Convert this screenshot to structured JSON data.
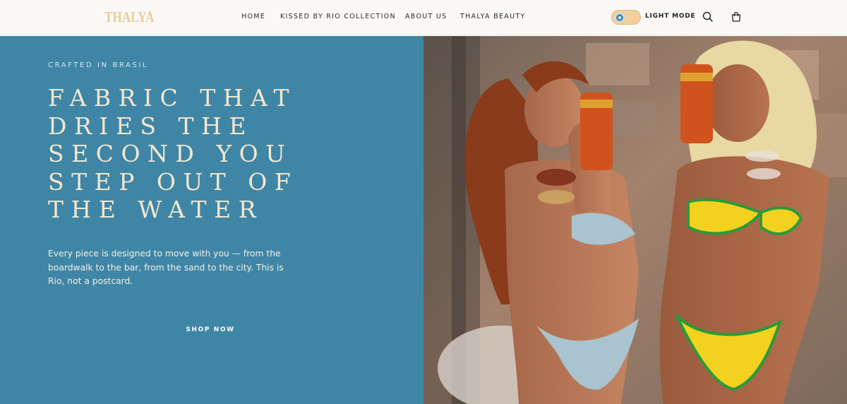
{
  "header": {
    "logo": "THALYA",
    "logo_mark": "™",
    "nav": [
      {
        "label": "HOME",
        "name": "nav-home"
      },
      {
        "label": "KISSED BY RIO COLLECTION",
        "name": "nav-kissed-by-rio-collection"
      },
      {
        "label": "ABOUT US",
        "name": "nav-about-us"
      },
      {
        "label": "THALYA BEAUTY",
        "name": "nav-thalya-beauty"
      }
    ],
    "mode_label": "LIGHT MODE",
    "icons": [
      "search-icon",
      "cart-icon"
    ]
  },
  "hero": {
    "eyebrow": "CRAFTED IN BRASIL",
    "headline": "FABRIC THAT DRIES THE SECOND YOU STEP OUT OF THE WATER",
    "body": "Every piece is designed to move with you — from the boardwalk to the bar, from the sand to the city. This is Rio, not a postcard.",
    "cta": "SHOP NOW"
  },
  "colors": {
    "hero_panel": "#3f86a6",
    "header_bg": "#fbf9f6",
    "logo": "#e6cd9c",
    "headline": "#f3e7cf",
    "toggle": "#f2cf9c"
  }
}
